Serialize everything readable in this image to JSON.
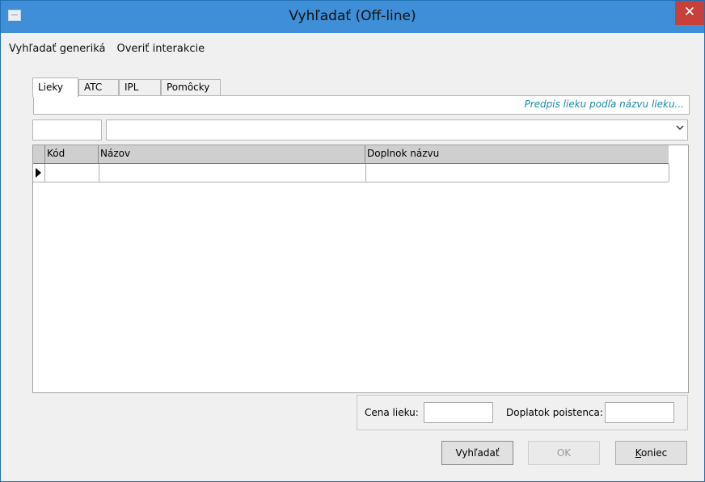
{
  "window": {
    "title": "Vyhľadať (Off-line)",
    "close_glyph": "✕"
  },
  "menu": [
    "Vyhľadať generiká",
    "Overiť interakcie"
  ],
  "tabs": [
    {
      "label": "Lieky",
      "active": true
    },
    {
      "label": "ATC",
      "active": false
    },
    {
      "label": "IPL",
      "active": false
    },
    {
      "label": "Pomôcky",
      "active": false
    }
  ],
  "hint": "Predpis lieku podľa názvu lieku...",
  "search": {
    "code_value": "",
    "name_value": ""
  },
  "grid": {
    "columns": [
      "Kód",
      "Názov",
      "Doplnok názvu"
    ],
    "rows": [
      [
        "",
        "",
        ""
      ]
    ]
  },
  "prices": {
    "price_label": "Cena lieku:",
    "price_value": "",
    "copay_label": "Doplatok poistenca:",
    "copay_value": ""
  },
  "buttons": {
    "search": "Vyhľadať",
    "ok": "OK",
    "end_first": "K",
    "end_rest": "oniec"
  },
  "colors": {
    "titlebar": "#3f8fd8",
    "close": "#c7403a",
    "hint": "#1a8aa8"
  }
}
